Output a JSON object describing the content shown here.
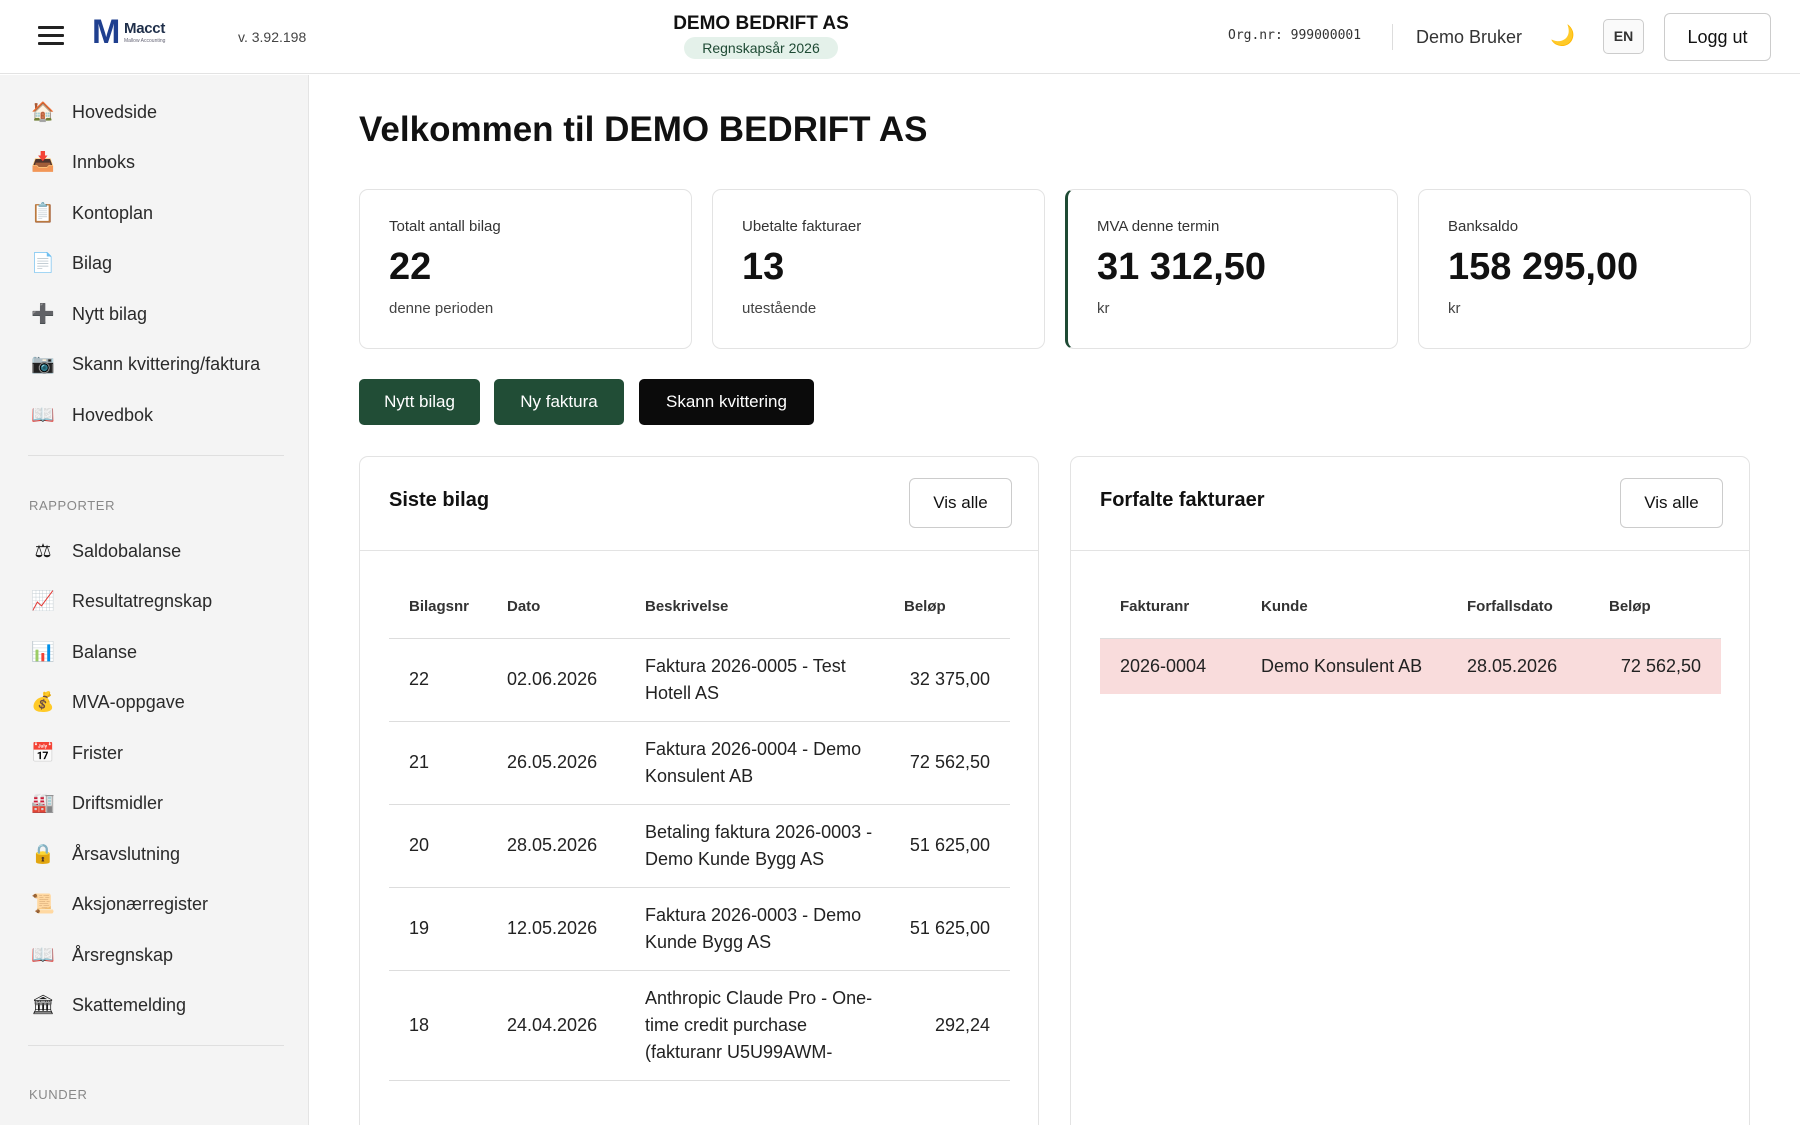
{
  "header": {
    "logo_text": "Macct",
    "logo_tagline": "Mallow Accounting",
    "version": "v. 3.92.198",
    "company": "DEMO BEDRIFT AS",
    "fiscal_year": "Regnskapsår 2026",
    "org_nr": "Org.nr: 999000001",
    "user": "Demo Bruker",
    "theme_icon": "🌙",
    "language": "EN",
    "logout": "Logg ut"
  },
  "sidebar": {
    "main_items": [
      {
        "icon": "🏠",
        "label": "Hovedside"
      },
      {
        "icon": "📥",
        "label": "Innboks"
      },
      {
        "icon": "📋",
        "label": "Kontoplan"
      },
      {
        "icon": "📄",
        "label": "Bilag"
      },
      {
        "icon": "➕",
        "label": "Nytt bilag"
      },
      {
        "icon": "📷",
        "label": "Skann kvittering/faktura"
      },
      {
        "icon": "📖",
        "label": "Hovedbok"
      }
    ],
    "reports_title": "RAPPORTER",
    "report_items": [
      {
        "icon": "⚖",
        "label": "Saldobalanse"
      },
      {
        "icon": "📈",
        "label": "Resultatregnskap"
      },
      {
        "icon": "📊",
        "label": "Balanse"
      },
      {
        "icon": "💰",
        "label": "MVA-oppgave"
      },
      {
        "icon": "📅",
        "label": "Frister"
      },
      {
        "icon": "🏭",
        "label": "Driftsmidler"
      },
      {
        "icon": "🔒",
        "label": "Årsavslutning"
      },
      {
        "icon": "📜",
        "label": "Aksjonærregister"
      },
      {
        "icon": "📖",
        "label": "Årsregnskap"
      },
      {
        "icon": "🏛",
        "label": "Skattemelding"
      }
    ],
    "customers_title": "KUNDER"
  },
  "main": {
    "welcome": "Velkommen til DEMO BEDRIFT AS",
    "stats": [
      {
        "label": "Totalt antall bilag",
        "value": "22",
        "sub": "denne perioden"
      },
      {
        "label": "Ubetalte fakturaer",
        "value": "13",
        "sub": "utestående"
      },
      {
        "label": "MVA denne termin",
        "value": "31 312,50",
        "sub": "kr"
      },
      {
        "label": "Banksaldo",
        "value": "158 295,00",
        "sub": "kr"
      }
    ],
    "actions": {
      "new_voucher": "Nytt bilag",
      "new_invoice": "Ny faktura",
      "scan_receipt": "Skann kvittering"
    },
    "recent_vouchers": {
      "title": "Siste bilag",
      "view_all": "Vis alle",
      "columns": [
        "Bilagsnr",
        "Dato",
        "Beskrivelse",
        "Beløp"
      ],
      "rows": [
        {
          "nr": "22",
          "date": "02.06.2026",
          "desc": "Faktura 2026-0005 - Test Hotell AS",
          "amount": "32 375,00"
        },
        {
          "nr": "21",
          "date": "26.05.2026",
          "desc": "Faktura 2026-0004 - Demo Konsulent AB",
          "amount": "72 562,50"
        },
        {
          "nr": "20",
          "date": "28.05.2026",
          "desc": "Betaling faktura 2026-0003 - Demo Kunde Bygg AS",
          "amount": "51 625,00"
        },
        {
          "nr": "19",
          "date": "12.05.2026",
          "desc": "Faktura 2026-0003 - Demo Kunde Bygg AS",
          "amount": "51 625,00"
        },
        {
          "nr": "18",
          "date": "24.04.2026",
          "desc": "Anthropic Claude Pro - One-time credit purchase (fakturanr U5U99AWM-",
          "amount": "292,24"
        }
      ]
    },
    "overdue_invoices": {
      "title": "Forfalte fakturaer",
      "view_all": "Vis alle",
      "columns": [
        "Fakturanr",
        "Kunde",
        "Forfallsdato",
        "Beløp"
      ],
      "rows": [
        {
          "nr": "2026-0004",
          "customer": "Demo Konsulent AB",
          "due": "28.05.2026",
          "amount": "72 562,50"
        }
      ]
    }
  }
}
